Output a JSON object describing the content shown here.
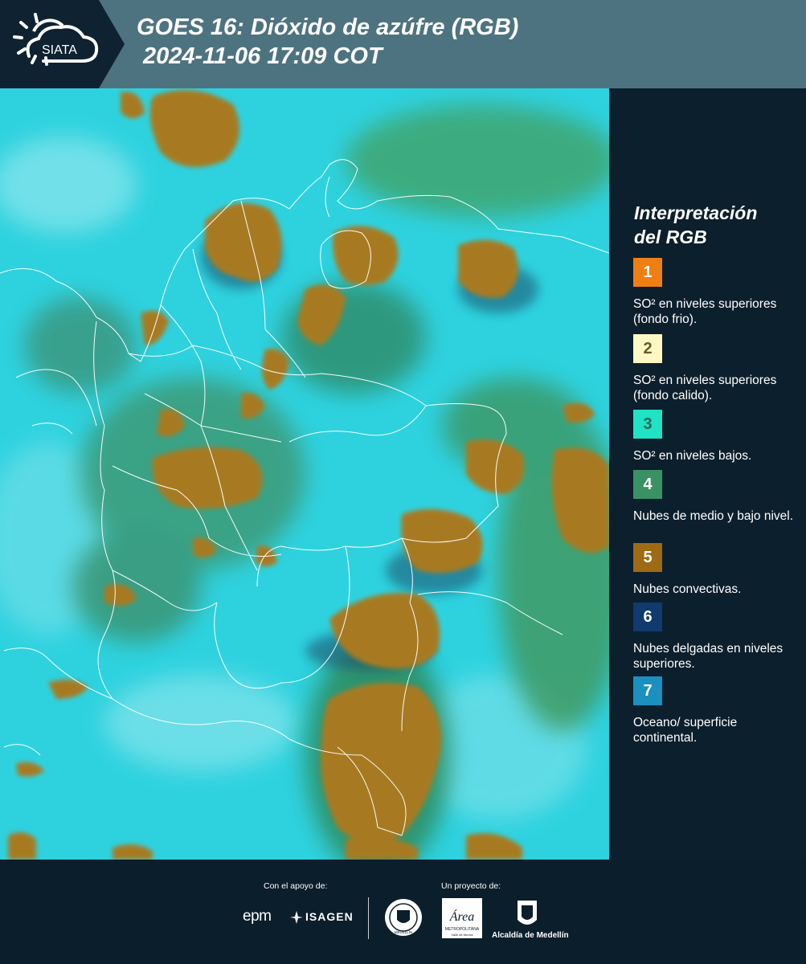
{
  "header": {
    "logo_text": "SIATA",
    "title_line1": "GOES 16: Dióxido de azúfre (RGB)",
    "title_line2": "2024-11-06 17:09 COT"
  },
  "map": {
    "ocean_color": "#2ed2df",
    "cloud_color": "#a77a22",
    "border_color": "#ffffff"
  },
  "legend": {
    "title_line1": "Interpretación",
    "title_line2": "del RGB",
    "items": [
      {
        "number": "1",
        "color": "#f07f13",
        "label": "SO² en niveles superiores (fondo frio)."
      },
      {
        "number": "2",
        "color": "#fff8c4",
        "label": "SO² en niveles superiores (fondo calido)."
      },
      {
        "number": "3",
        "color": "#1fe3c4",
        "label": "SO² en niveles bajos."
      },
      {
        "number": "4",
        "color": "#3a9264",
        "label": "Nubes de medio y bajo nivel."
      },
      {
        "number": "5",
        "color": "#9e6a13",
        "label": "Nubes convectivas."
      },
      {
        "number": "6",
        "color": "#113a6e",
        "label": "Nubes delgadas en niveles superiores."
      },
      {
        "number": "7",
        "color": "#1b8fbe",
        "label": "Oceano/ superficie continental."
      }
    ]
  },
  "footer": {
    "support_caption": "Con el apoyo de:",
    "project_caption": "Un proyecto de:",
    "sponsor_epm": "epm",
    "sponsor_isagen": "ISAGEN",
    "seal_text": "MEDELLÍN",
    "area_logo_text": "Área",
    "area_logo_sub": "METROPOLITANA",
    "area_logo_sub2": "Valle de Aburrá",
    "alcaldia_text": "Alcaldía de Medellín"
  }
}
